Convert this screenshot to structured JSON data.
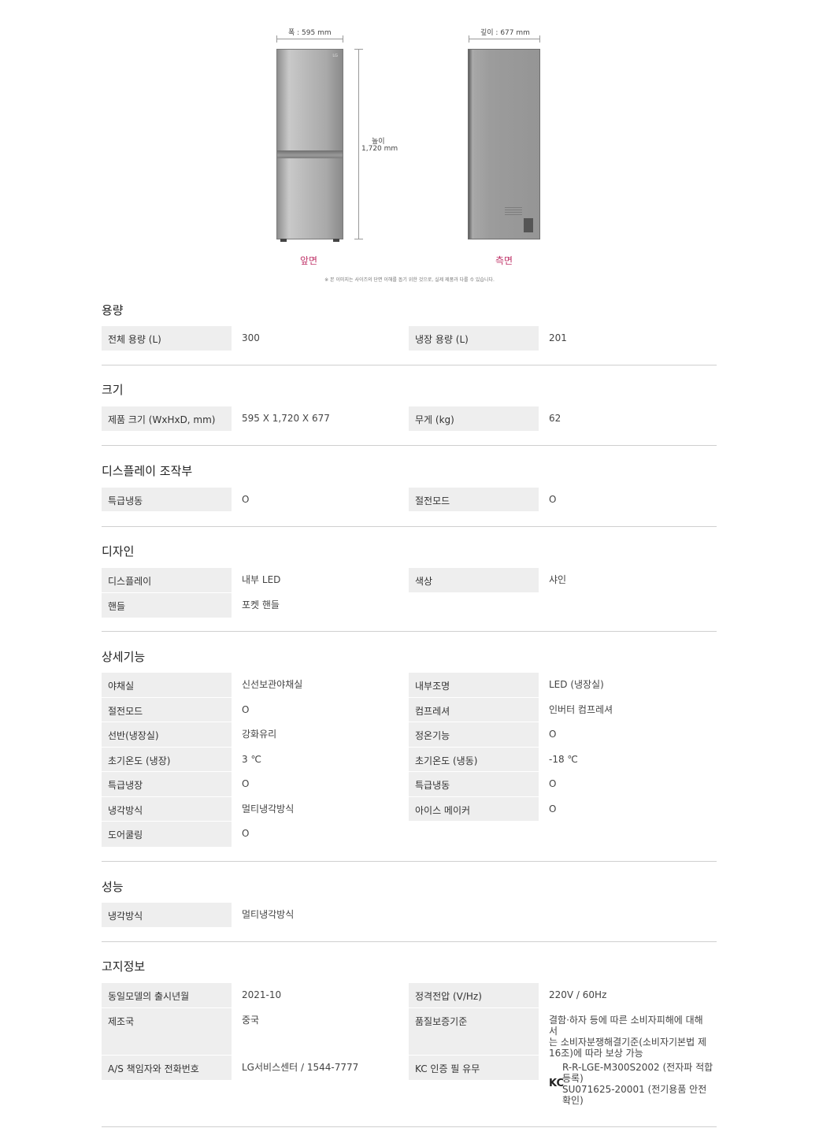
{
  "figure": {
    "width_label": "폭 : 595 mm",
    "depth_label": "깊이 : 677 mm",
    "height_label_1": "높이",
    "height_label_2": "1,720 mm",
    "front_label": "앞면",
    "side_label": "측면",
    "brand_mark": "LG",
    "note": "※ 본 이미지는 사이즈의 단면 이해를 돕기 위한 것으로, 실제 제품과 다를 수 있습니다."
  },
  "sections": {
    "capacity": {
      "title": "용량",
      "rows": [
        [
          "전체 용량 (L)",
          "300",
          "냉장 용량 (L)",
          "201"
        ]
      ]
    },
    "size": {
      "title": "크기",
      "rows": [
        [
          "제품 크기 (WxHxD, mm)",
          "595 X 1,720 X 677",
          "무게 (kg)",
          "62"
        ]
      ]
    },
    "display": {
      "title": "디스플레이 조작부",
      "rows": [
        [
          "특급냉동",
          "O",
          "절전모드",
          "O"
        ]
      ]
    },
    "design": {
      "title": "디자인",
      "rows": [
        [
          "디스플레이",
          "내부 LED",
          "색상",
          "샤인"
        ],
        [
          "핸들",
          "포켓 핸들",
          "",
          ""
        ]
      ]
    },
    "features": {
      "title": "상세기능",
      "rows": [
        [
          "야채실",
          "신선보관야채실",
          "내부조명",
          "LED (냉장실)"
        ],
        [
          "절전모드",
          "O",
          "컴프레셔",
          "인버터 컴프레셔"
        ],
        [
          "선반(냉장실)",
          "강화유리",
          "정온기능",
          "O"
        ],
        [
          "초기온도 (냉장)",
          "3 ℃",
          "초기온도 (냉동)",
          "-18 ℃"
        ],
        [
          "특급냉장",
          "O",
          "특급냉동",
          "O"
        ],
        [
          "냉각방식",
          "멀티냉각방식",
          "아이스 메이커",
          "O"
        ],
        [
          "도어쿨링",
          "O",
          "",
          ""
        ]
      ]
    },
    "performance": {
      "title": "성능",
      "rows": [
        [
          "냉각방식",
          "멀티냉각방식",
          "",
          ""
        ]
      ]
    },
    "notice": {
      "title": "고지정보",
      "rows": [
        [
          "동일모델의 출시년월",
          "2021-10",
          "정격전압 (V/Hz)",
          "220V / 60Hz"
        ],
        [
          "제조국",
          "중국",
          "품질보증기준",
          "결함·하자 등에 따른 소비자피해에 대해서는 소비자분쟁해결기준(소비자기본법 제16조)에 따라 보상 가능"
        ],
        [
          "A/S 책임자와 전화번호",
          "LG서비스센터 / 1544-7777",
          "KC 인증 필 유무",
          "R-R-LGE-M300S2002 (전자파 적합등록) SU071625-20001 (전기용품 안전확인)"
        ]
      ],
      "kc_line1": "R-R-LGE-M300S2002 (전자파 적합",
      "kc_line2": "등록)",
      "kc_line3": "SU071625-20001 (전기용품 안전",
      "kc_line4": "확인)",
      "kc_mark": "KC",
      "warranty_line1": "결함·하자 등에 따른 소비자피해에 대해서",
      "warranty_line2": "는 소비자분쟁해결기준(소비자기본법 제",
      "warranty_line3": "16조)에 따라 보상 가능"
    }
  }
}
